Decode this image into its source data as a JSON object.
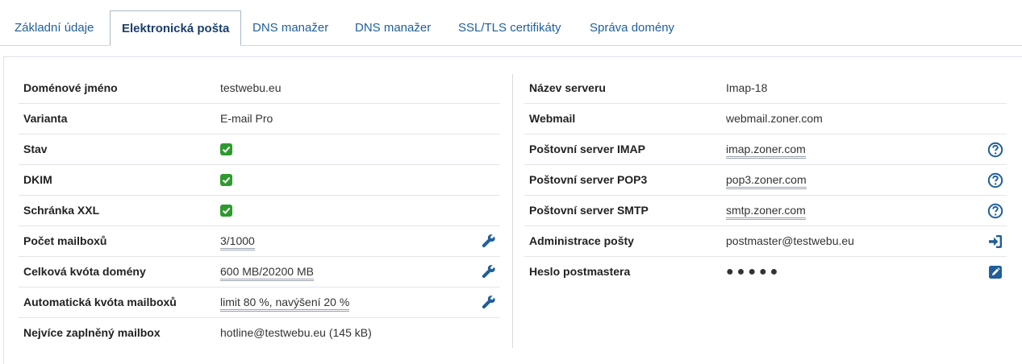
{
  "tabs": [
    {
      "label": "Základní údaje",
      "active": false
    },
    {
      "label": "Elektronická pošta",
      "active": true
    },
    {
      "label": "DNS manažer",
      "active": false
    },
    {
      "label": "DNS manažer",
      "active": false
    },
    {
      "label": "SSL/TLS certifikáty",
      "active": false
    },
    {
      "label": "Správa domény",
      "active": false
    }
  ],
  "left": {
    "domain_name": {
      "label": "Doménové jméno",
      "value": "testwebu.eu"
    },
    "variant": {
      "label": "Varianta",
      "value": "E-mail Pro"
    },
    "status": {
      "label": "Stav",
      "checked": true
    },
    "dkim": {
      "label": "DKIM",
      "checked": true
    },
    "xxl": {
      "label": "Schránka XXL",
      "checked": true
    },
    "mailbox_count": {
      "label": "Počet mailboxů",
      "value": "3/1000"
    },
    "total_quota": {
      "label": "Celková kvóta domény",
      "value": "600 MB/20200 MB"
    },
    "auto_quota": {
      "label": "Automatická kvóta mailboxů",
      "value": "limit 80 %, navýšení 20 %"
    },
    "fullest": {
      "label": "Nejvíce zaplněný mailbox",
      "value": "hotline@testwebu.eu (145 kB)"
    }
  },
  "right": {
    "server_name": {
      "label": "Název serveru",
      "value": "Imap-18"
    },
    "webmail": {
      "label": "Webmail",
      "value": "webmail.zoner.com"
    },
    "imap": {
      "label": "Poštovní server IMAP",
      "value": "imap.zoner.com"
    },
    "pop3": {
      "label": "Poštovní server POP3",
      "value": "pop3.zoner.com"
    },
    "smtp": {
      "label": "Poštovní server SMTP",
      "value": "smtp.zoner.com"
    },
    "admin": {
      "label": "Administrace pošty",
      "value": "postmaster@testwebu.eu"
    },
    "password": {
      "label": "Heslo postmastera",
      "value": "●●●●●"
    }
  },
  "colors": {
    "accent": "#1f5f9a",
    "check": "#2e9a2e"
  }
}
